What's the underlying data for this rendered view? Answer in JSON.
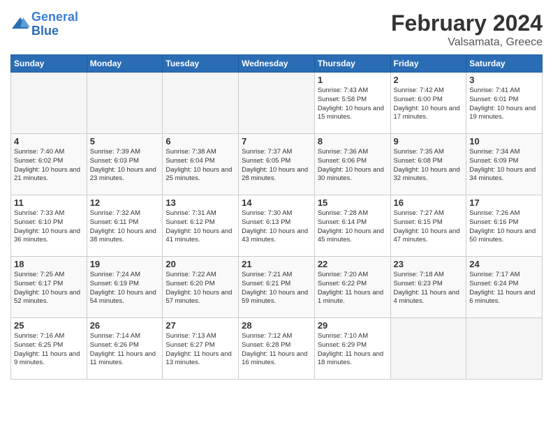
{
  "logo": {
    "line1": "General",
    "line2": "Blue"
  },
  "title": "February 2024",
  "subtitle": "Valsamata, Greece",
  "header": {
    "days": [
      "Sunday",
      "Monday",
      "Tuesday",
      "Wednesday",
      "Thursday",
      "Friday",
      "Saturday"
    ]
  },
  "weeks": [
    {
      "cells": [
        {
          "day": "",
          "empty": true
        },
        {
          "day": "",
          "empty": true
        },
        {
          "day": "",
          "empty": true
        },
        {
          "day": "",
          "empty": true
        },
        {
          "day": "1",
          "sunrise": "7:43 AM",
          "sunset": "5:58 PM",
          "daylight": "10 hours and 15 minutes."
        },
        {
          "day": "2",
          "sunrise": "7:42 AM",
          "sunset": "6:00 PM",
          "daylight": "10 hours and 17 minutes."
        },
        {
          "day": "3",
          "sunrise": "7:41 AM",
          "sunset": "6:01 PM",
          "daylight": "10 hours and 19 minutes."
        }
      ]
    },
    {
      "cells": [
        {
          "day": "4",
          "sunrise": "7:40 AM",
          "sunset": "6:02 PM",
          "daylight": "10 hours and 21 minutes."
        },
        {
          "day": "5",
          "sunrise": "7:39 AM",
          "sunset": "6:03 PM",
          "daylight": "10 hours and 23 minutes."
        },
        {
          "day": "6",
          "sunrise": "7:38 AM",
          "sunset": "6:04 PM",
          "daylight": "10 hours and 25 minutes."
        },
        {
          "day": "7",
          "sunrise": "7:37 AM",
          "sunset": "6:05 PM",
          "daylight": "10 hours and 28 minutes."
        },
        {
          "day": "8",
          "sunrise": "7:36 AM",
          "sunset": "6:06 PM",
          "daylight": "10 hours and 30 minutes."
        },
        {
          "day": "9",
          "sunrise": "7:35 AM",
          "sunset": "6:08 PM",
          "daylight": "10 hours and 32 minutes."
        },
        {
          "day": "10",
          "sunrise": "7:34 AM",
          "sunset": "6:09 PM",
          "daylight": "10 hours and 34 minutes."
        }
      ]
    },
    {
      "cells": [
        {
          "day": "11",
          "sunrise": "7:33 AM",
          "sunset": "6:10 PM",
          "daylight": "10 hours and 36 minutes."
        },
        {
          "day": "12",
          "sunrise": "7:32 AM",
          "sunset": "6:11 PM",
          "daylight": "10 hours and 38 minutes."
        },
        {
          "day": "13",
          "sunrise": "7:31 AM",
          "sunset": "6:12 PM",
          "daylight": "10 hours and 41 minutes."
        },
        {
          "day": "14",
          "sunrise": "7:30 AM",
          "sunset": "6:13 PM",
          "daylight": "10 hours and 43 minutes."
        },
        {
          "day": "15",
          "sunrise": "7:28 AM",
          "sunset": "6:14 PM",
          "daylight": "10 hours and 45 minutes."
        },
        {
          "day": "16",
          "sunrise": "7:27 AM",
          "sunset": "6:15 PM",
          "daylight": "10 hours and 47 minutes."
        },
        {
          "day": "17",
          "sunrise": "7:26 AM",
          "sunset": "6:16 PM",
          "daylight": "10 hours and 50 minutes."
        }
      ]
    },
    {
      "cells": [
        {
          "day": "18",
          "sunrise": "7:25 AM",
          "sunset": "6:17 PM",
          "daylight": "10 hours and 52 minutes."
        },
        {
          "day": "19",
          "sunrise": "7:24 AM",
          "sunset": "6:19 PM",
          "daylight": "10 hours and 54 minutes."
        },
        {
          "day": "20",
          "sunrise": "7:22 AM",
          "sunset": "6:20 PM",
          "daylight": "10 hours and 57 minutes."
        },
        {
          "day": "21",
          "sunrise": "7:21 AM",
          "sunset": "6:21 PM",
          "daylight": "10 hours and 59 minutes."
        },
        {
          "day": "22",
          "sunrise": "7:20 AM",
          "sunset": "6:22 PM",
          "daylight": "11 hours and 1 minute."
        },
        {
          "day": "23",
          "sunrise": "7:18 AM",
          "sunset": "6:23 PM",
          "daylight": "11 hours and 4 minutes."
        },
        {
          "day": "24",
          "sunrise": "7:17 AM",
          "sunset": "6:24 PM",
          "daylight": "11 hours and 6 minutes."
        }
      ]
    },
    {
      "cells": [
        {
          "day": "25",
          "sunrise": "7:16 AM",
          "sunset": "6:25 PM",
          "daylight": "11 hours and 9 minutes."
        },
        {
          "day": "26",
          "sunrise": "7:14 AM",
          "sunset": "6:26 PM",
          "daylight": "11 hours and 11 minutes."
        },
        {
          "day": "27",
          "sunrise": "7:13 AM",
          "sunset": "6:27 PM",
          "daylight": "11 hours and 13 minutes."
        },
        {
          "day": "28",
          "sunrise": "7:12 AM",
          "sunset": "6:28 PM",
          "daylight": "11 hours and 16 minutes."
        },
        {
          "day": "29",
          "sunrise": "7:10 AM",
          "sunset": "6:29 PM",
          "daylight": "11 hours and 18 minutes."
        },
        {
          "day": "",
          "empty": true
        },
        {
          "day": "",
          "empty": true
        }
      ]
    }
  ]
}
